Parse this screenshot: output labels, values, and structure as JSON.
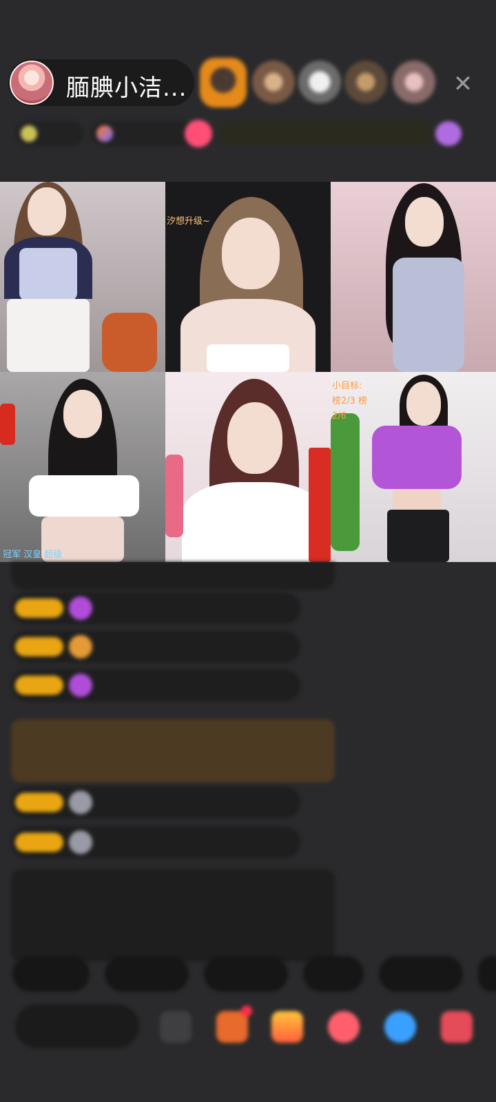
{
  "host": {
    "name": "腼腆小洁..."
  },
  "top_actions": {
    "close_glyph": "✕"
  },
  "video_tiles": [
    {
      "caption": ""
    },
    {
      "caption": "汐想升级~"
    },
    {
      "caption": ""
    },
    {
      "caption": "冠军 汉皇 超级"
    },
    {
      "caption": ""
    },
    {
      "caption": "小目标: 榜2/3 榜2/6"
    }
  ],
  "colors": {
    "badge_gold": "#e9a612",
    "gem_purple": "#b04dd8",
    "name_blue": "#5aa6d6",
    "name_green": "#6fb36a",
    "notice_bg": "#4c3a22",
    "system_green": "#7fc87a"
  }
}
